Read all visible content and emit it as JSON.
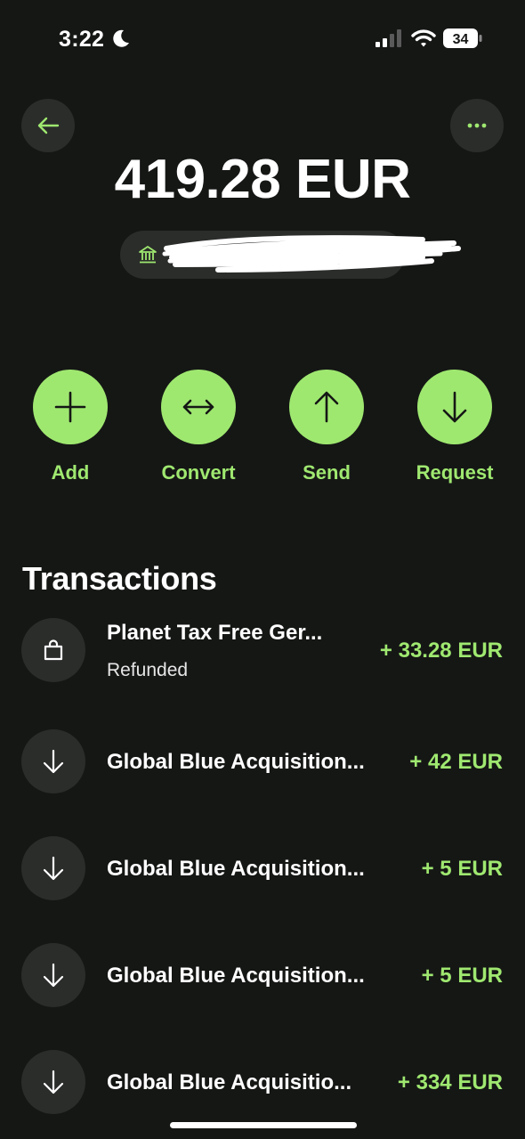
{
  "status_bar": {
    "time": "3:22",
    "battery": "34"
  },
  "balance": {
    "amount": "419.28 EUR"
  },
  "actions": [
    {
      "label": "Add",
      "icon": "plus-icon"
    },
    {
      "label": "Convert",
      "icon": "convert-arrows-icon"
    },
    {
      "label": "Send",
      "icon": "arrow-up-icon"
    },
    {
      "label": "Request",
      "icon": "arrow-down-icon"
    }
  ],
  "transactions": {
    "title": "Transactions",
    "items": [
      {
        "name": "Planet Tax Free Ger...",
        "status": "Refunded",
        "amount": "+ 33.28 EUR",
        "icon": "shopping-bag-icon"
      },
      {
        "name": "Global Blue Acquisition...",
        "amount": "+ 42 EUR",
        "icon": "arrow-down-icon"
      },
      {
        "name": "Global Blue Acquisition...",
        "amount": "+ 5 EUR",
        "icon": "arrow-down-icon"
      },
      {
        "name": "Global Blue Acquisition...",
        "amount": "+ 5 EUR",
        "icon": "arrow-down-icon"
      },
      {
        "name": "Global Blue Acquisitio...",
        "amount": "+ 334 EUR",
        "icon": "arrow-down-icon"
      }
    ]
  },
  "colors": {
    "background": "#151715",
    "accent_green": "#9fe870",
    "surface": "#2b2d2b",
    "text": "#ffffff"
  }
}
